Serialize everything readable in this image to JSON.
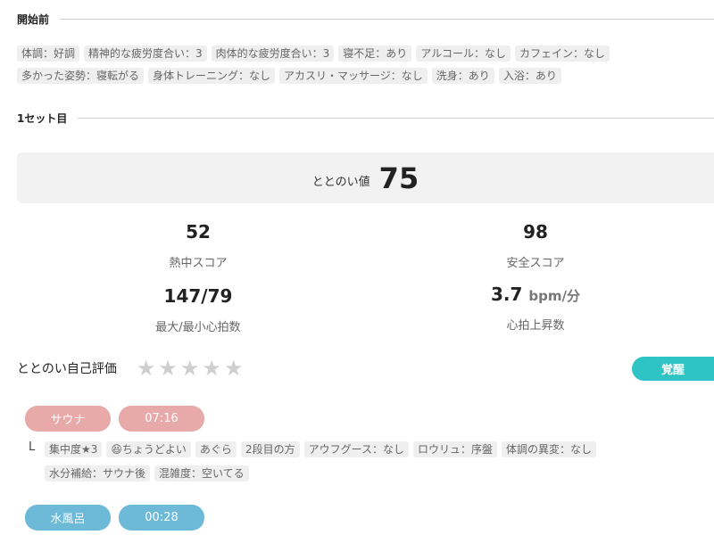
{
  "before": {
    "title": "開始前",
    "tags_row1": [
      "体調：好調",
      "精神的な疲労度合い：3",
      "肉体的な疲労度合い：3",
      "寝不足：あり",
      "アルコール：なし",
      "カフェイン：なし"
    ],
    "tags_row2": [
      "多かった姿勢：寝転がる",
      "身体トレーニング：なし",
      "アカスリ・マッサージ：なし",
      "洗身：あり",
      "入浴：あり"
    ]
  },
  "set1": {
    "title": "1セット目",
    "totonoi_label": "ととのい値",
    "totonoi_value": "75",
    "stats": [
      {
        "value": "52",
        "unit": "",
        "caption": "熱中スコア"
      },
      {
        "value": "98",
        "unit": "",
        "caption": "安全スコア"
      },
      {
        "value": "147/79",
        "unit": "",
        "caption": "最大/最小心拍数"
      },
      {
        "value": "3.7",
        "unit": "bpm/分",
        "caption": "心拍上昇数"
      }
    ],
    "self_eval_label": "ととのい自己評価",
    "rating": 0,
    "rating_max": 5,
    "badge": "覚醒",
    "sauna": {
      "label": "サウナ",
      "time": "07:16",
      "branch": "L",
      "tags_row1": [
        "集中度★3",
        "😆ちょうどよい",
        "あぐら",
        "2段目の方",
        "アウフグース：なし",
        "ロウリュ：序盤",
        "体調の異変：なし"
      ],
      "tags_row2": [
        "水分補給：サウナ後",
        "混雑度：空いてる"
      ]
    },
    "mizuburo": {
      "label": "水風呂",
      "time": "00:28"
    }
  },
  "colors": {
    "sauna_pill": "#e8a9a9",
    "mizu_pill": "#6cb9d8",
    "badge": "#2ec4c6",
    "tag_bg": "#efefef",
    "star_off": "#cfcfcf"
  }
}
